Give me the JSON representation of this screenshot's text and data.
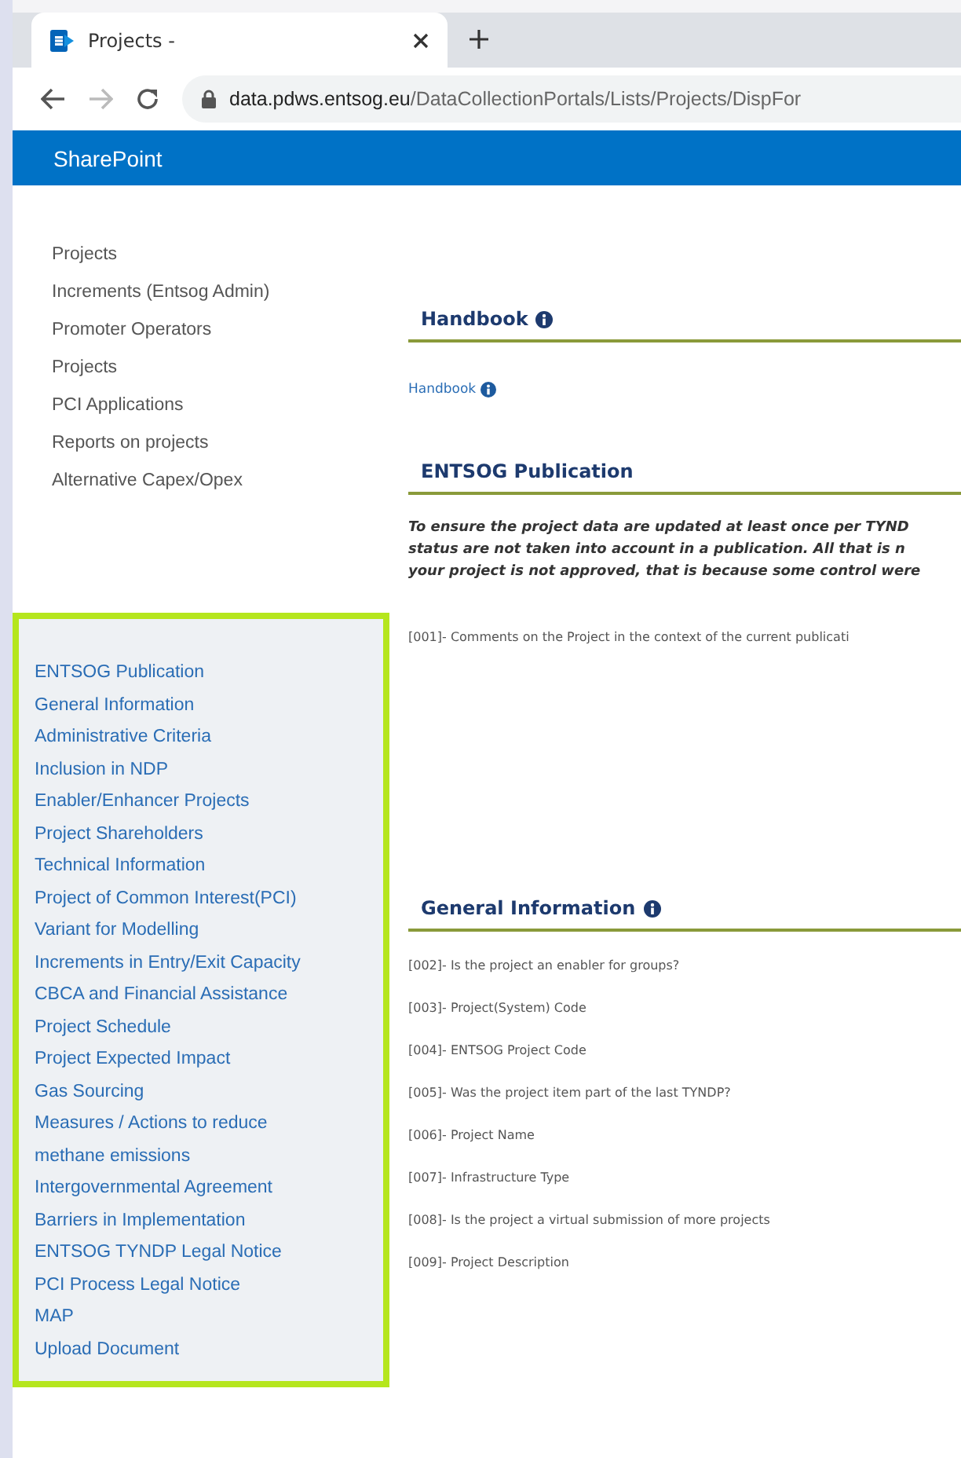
{
  "browser": {
    "tab": {
      "title": "Projects -"
    },
    "address": {
      "host": "data.pdws.entsog.eu",
      "path": "/DataCollectionPortals/Lists/Projects/DispFor"
    }
  },
  "suite_bar": {
    "title": "SharePoint"
  },
  "top_nav": [
    "Projects",
    "Increments (Entsog Admin)",
    "Promoter Operators",
    "Projects",
    "PCI Applications",
    "Reports on projects",
    "Alternative Capex/Opex"
  ],
  "section_nav": [
    "ENTSOG Publication",
    "General Information",
    "Administrative Criteria",
    "Inclusion in NDP",
    "Enabler/Enhancer Projects",
    "Project Shareholders",
    "Technical Information",
    "Project of Common Interest(PCI)",
    "Variant for Modelling",
    "Increments in Entry/Exit Capacity",
    "CBCA and Financial Assistance",
    "Project Schedule",
    "Project Expected Impact",
    "Gas Sourcing",
    "Measures / Actions to reduce methane emissions",
    "Intergovernmental Agreement",
    "Barriers in Implementation",
    "ENTSOG TYNDP Legal Notice",
    "PCI Process Legal Notice",
    "MAP",
    "Upload Document"
  ],
  "sections": [
    {
      "title": "Handbook",
      "info": true,
      "kind": "links",
      "items": [
        "Handbook"
      ]
    },
    {
      "title": "ENTSOG Publication",
      "info": false,
      "kind": "notice",
      "note_lines": [
        "To ensure the project data are updated at least once per TYND",
        "status are not taken into account in a publication. All that is n",
        "your project is not approved, that is because some control were"
      ],
      "items": [
        "[001]- Comments on the Project in the context of the current publicati"
      ]
    },
    {
      "title": "General Information",
      "info": true,
      "kind": "fields",
      "items": [
        "[002]- Is the project an enabler for groups?",
        "[003]- Project(System) Code",
        "[004]- ENTSOG Project Code",
        "[005]- Was the project item part of the last TYNDP?",
        "[006]- Project Name",
        "[007]- Infrastructure Type",
        "[008]- Is the project a virtual submission of more projects",
        "[009]- Project Description"
      ]
    }
  ]
}
